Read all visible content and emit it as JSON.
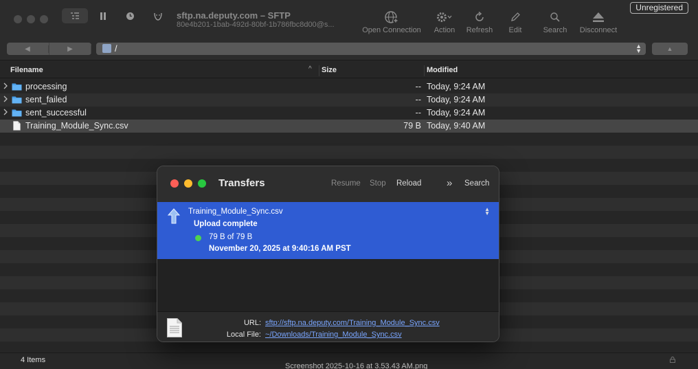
{
  "window": {
    "title": "sftp.na.deputy.com – SFTP",
    "subtitle": "80e4b201-1bab-492d-80bf-1b786fbc8d00@s...",
    "badge": "Unregistered"
  },
  "toolbar": {
    "items": [
      {
        "label": "Open Connection",
        "icon": "globe-plus-icon"
      },
      {
        "label": "Action",
        "icon": "gear-icon"
      },
      {
        "label": "Refresh",
        "icon": "refresh-icon"
      },
      {
        "label": "Edit",
        "icon": "pencil-icon"
      },
      {
        "label": "Search",
        "icon": "search-icon"
      },
      {
        "label": "Disconnect",
        "icon": "eject-icon"
      }
    ]
  },
  "path": {
    "value": "/"
  },
  "columns": {
    "filename": "Filename",
    "size": "Size",
    "modified": "Modified"
  },
  "files": [
    {
      "name": "processing",
      "size": "--",
      "modified": "Today, 9:24 AM",
      "kind": "folder"
    },
    {
      "name": "sent_failed",
      "size": "--",
      "modified": "Today, 9:24 AM",
      "kind": "folder"
    },
    {
      "name": "sent_successful",
      "size": "--",
      "modified": "Today, 9:24 AM",
      "kind": "folder"
    },
    {
      "name": "Training_Module_Sync.csv",
      "size": "79 B",
      "modified": "Today, 9:40 AM",
      "kind": "file"
    }
  ],
  "status": {
    "count": "4 Items"
  },
  "background_text": "Screenshot 2025-10-16 at 3.53.43 AM.png",
  "transfers": {
    "title": "Transfers",
    "buttons": {
      "resume": "Resume",
      "stop": "Stop",
      "reload": "Reload",
      "search": "Search"
    },
    "item": {
      "filename": "Training_Module_Sync.csv",
      "state": "Upload complete",
      "progress": "79 B of 79 B",
      "date": "November 20, 2025 at 9:40:16 AM PST"
    },
    "url_label": "URL:",
    "url": "sftp://sftp.na.deputy.com/Training_Module_Sync.csv",
    "local_label": "Local File:",
    "local": "~/Downloads/Training_Module_Sync.csv"
  }
}
